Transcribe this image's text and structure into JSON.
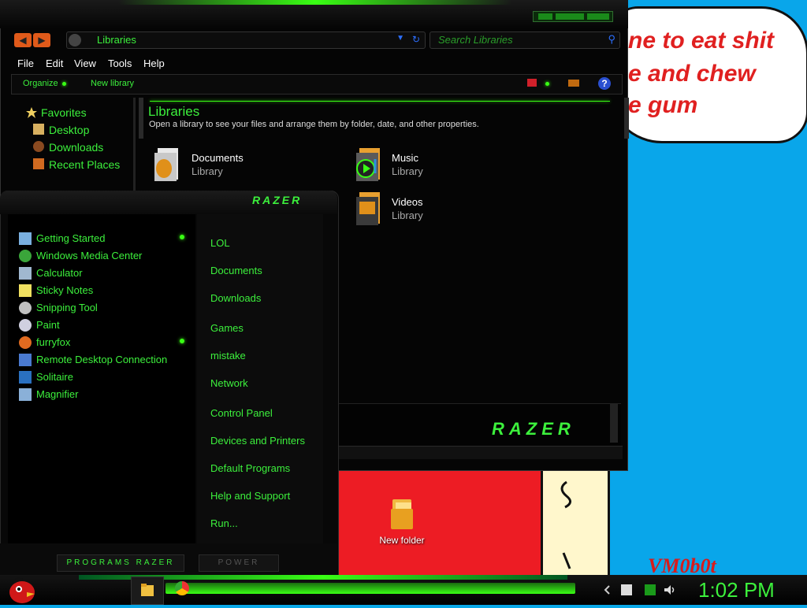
{
  "desktop": {
    "bubble_lines": [
      "ne to eat shit",
      "e and chew",
      "e gum"
    ],
    "watermark": "VM0b0t",
    "folder_label": "New folder"
  },
  "explorer": {
    "address": "Libraries",
    "search_placeholder": "Search Libraries",
    "menu": [
      "File",
      "Edit",
      "View",
      "Tools",
      "Help"
    ],
    "commands": {
      "organize": "Organize",
      "new_library": "New library"
    },
    "nav": [
      "Favorites",
      "Desktop",
      "Downloads",
      "Recent Places"
    ],
    "header": {
      "title": "Libraries",
      "subtitle": "Open a library to see your files and arrange them by folder, date, and other properties."
    },
    "libraries": [
      {
        "name": "Documents",
        "type": "Library"
      },
      {
        "name": "Music",
        "type": "Library"
      },
      {
        "name": "Videos",
        "type": "Library"
      }
    ],
    "brand": "RAZER"
  },
  "startmenu": {
    "brand": "RAZER",
    "programs": [
      "Getting Started",
      "Windows Media Center",
      "Calculator",
      "Sticky Notes",
      "Snipping Tool",
      "Paint",
      "furryfox",
      "Remote Desktop Connection",
      "Solitaire",
      "Magnifier"
    ],
    "places": [
      "LOL",
      "Documents",
      "Downloads",
      "Games",
      "mistake",
      "Network",
      "Control Panel",
      "Devices and Printers",
      "Default Programs",
      "Help and Support",
      "Run..."
    ],
    "programs_label": "PROGRAMS RAZER",
    "power_label": "POWER"
  },
  "taskbar": {
    "clock": "1:02 PM"
  },
  "colors": {
    "accent": "#39ff14",
    "text_green": "#3cf03c"
  }
}
